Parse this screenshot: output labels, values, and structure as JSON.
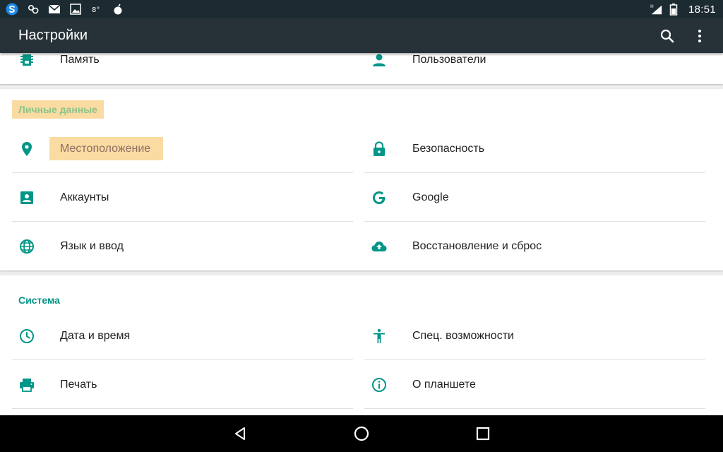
{
  "status_bar": {
    "time": "18:51",
    "network_type": "H",
    "left_icons": [
      "s-app-icon",
      "settings-gear-icon",
      "mail-icon",
      "image-icon",
      "voicemail-icon",
      "bomb-icon"
    ],
    "right_icons": [
      "signal-icon",
      "battery-icon"
    ]
  },
  "toolbar": {
    "title": "Настройки",
    "actions": [
      "search-icon",
      "more-vert-icon"
    ]
  },
  "top_row": {
    "left_label": "Память",
    "right_label": "Пользователи"
  },
  "personal": {
    "header": "Личные данные",
    "items": [
      {
        "label": "Местоположение",
        "icon": "location-pin-icon"
      },
      {
        "label": "Безопасность",
        "icon": "lock-icon"
      },
      {
        "label": "Аккаунты",
        "icon": "account-box-icon"
      },
      {
        "label": "Google",
        "icon": "google-g-icon"
      },
      {
        "label": "Язык и ввод",
        "icon": "globe-icon"
      },
      {
        "label": "Восстановление и сброс",
        "icon": "cloud-upload-icon"
      }
    ]
  },
  "system": {
    "header": "Система",
    "items": [
      {
        "label": "Дата и время",
        "icon": "clock-icon"
      },
      {
        "label": "Спец. возможности",
        "icon": "accessibility-icon"
      },
      {
        "label": "Печать",
        "icon": "printer-icon"
      },
      {
        "label": "О планшете",
        "icon": "info-icon"
      }
    ]
  },
  "nav_bar": [
    "back-icon",
    "home-icon",
    "recents-icon"
  ],
  "colors": {
    "accent": "#009688",
    "toolbar": "#263238",
    "status_bar": "#1c2a31",
    "highlight": "#fadba2"
  }
}
